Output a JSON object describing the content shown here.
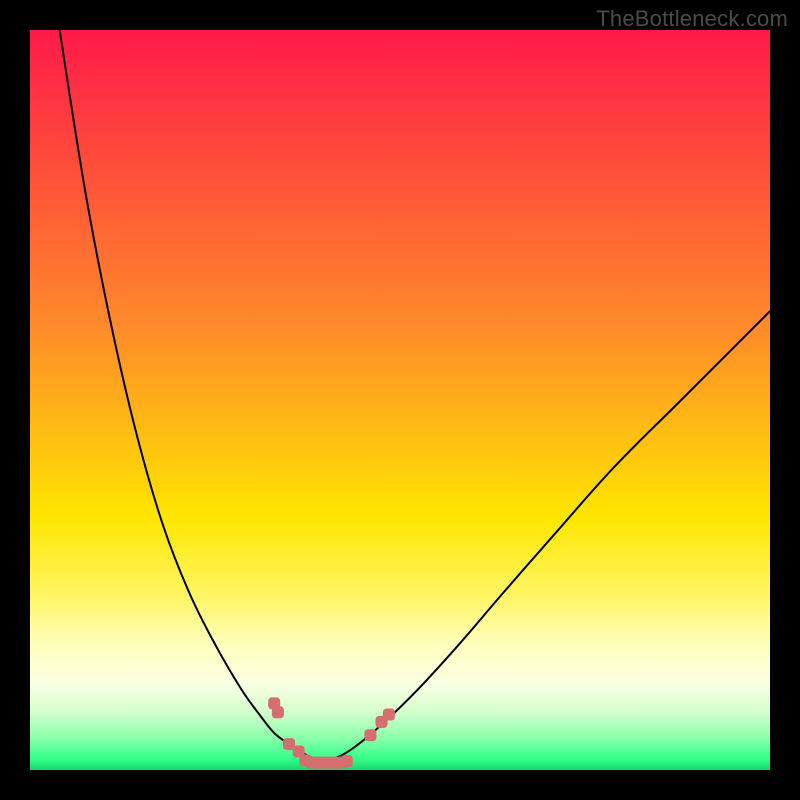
{
  "watermark": "TheBottleneck.com",
  "chart_data": {
    "type": "line",
    "title": "",
    "xlabel": "",
    "ylabel": "",
    "xlim": [
      0,
      100
    ],
    "ylim": [
      0,
      100
    ],
    "background_gradient": {
      "stops": [
        {
          "offset": 0.0,
          "color": "#ff1a49"
        },
        {
          "offset": 0.4,
          "color": "#ff8a2a"
        },
        {
          "offset": 0.66,
          "color": "#ffe600"
        },
        {
          "offset": 0.77,
          "color": "#fff66a"
        },
        {
          "offset": 0.83,
          "color": "#ffffbc"
        },
        {
          "offset": 0.885,
          "color": "#f9ffe3"
        },
        {
          "offset": 0.92,
          "color": "#d6ffce"
        },
        {
          "offset": 0.955,
          "color": "#8fffad"
        },
        {
          "offset": 0.985,
          "color": "#34ff8a"
        },
        {
          "offset": 1.0,
          "color": "#17d46f"
        }
      ]
    },
    "series": [
      {
        "name": "bottleneck-curve-left",
        "type": "line",
        "stroke": "#000000",
        "stroke_width": 2.0,
        "x": [
          4,
          7.5,
          11,
          14.5,
          18,
          21.5,
          25,
          28.5,
          31,
          33,
          35,
          36.5,
          38,
          39,
          40
        ],
        "y": [
          0,
          22,
          40,
          55,
          67,
          76,
          83,
          89,
          92.5,
          95,
          96.5,
          97.5,
          98.3,
          98.8,
          99
        ]
      },
      {
        "name": "bottleneck-curve-right",
        "type": "line",
        "stroke": "#000000",
        "stroke_width": 2.0,
        "x": [
          40,
          41,
          42.5,
          44,
          46,
          49,
          53,
          58,
          64,
          71,
          79,
          88,
          100
        ],
        "y": [
          99,
          98.5,
          97.8,
          96.8,
          95.2,
          92.5,
          88.5,
          83,
          76,
          68,
          59,
          50,
          38
        ]
      },
      {
        "name": "accent-markers",
        "type": "scatter",
        "fill": "#d46e6f",
        "marker_size": 12,
        "x": [
          33.0,
          33.5,
          35.0,
          36.3,
          37.2,
          38.1,
          39.0,
          39.8,
          40.5,
          41.2,
          42.0,
          42.8,
          46.0,
          47.5,
          48.5
        ],
        "y": [
          91.0,
          92.2,
          96.5,
          97.5,
          98.7,
          99.0,
          99.0,
          99.0,
          99.0,
          99.0,
          99.0,
          98.8,
          95.3,
          93.5,
          92.5
        ]
      }
    ]
  }
}
